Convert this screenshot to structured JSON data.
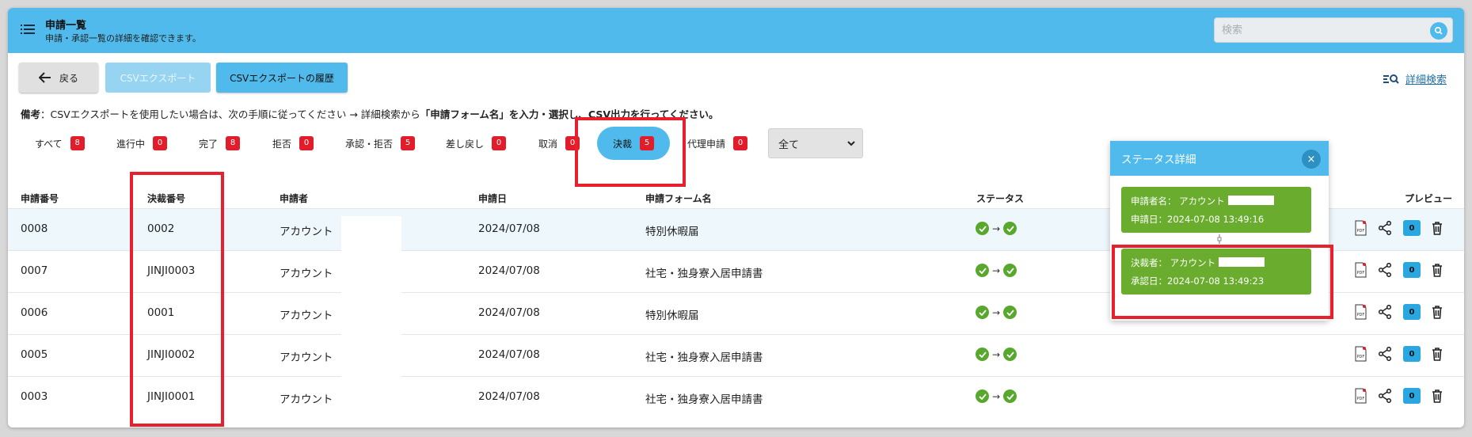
{
  "header": {
    "title": "申請一覧",
    "subtitle": "申請・承認一覧の詳細を確認できます。",
    "search_placeholder": "検索"
  },
  "toolbar": {
    "back_label": "戻る",
    "csv_export_label": "CSVエクスポート",
    "csv_history_label": "CSVエクスポートの履歴",
    "advanced_search_label": "詳細検索"
  },
  "note": {
    "prefix": "備考",
    "text": "：CSVエクスポートを使用したい場合は、次の手順に従ってください → 詳細検索から",
    "emphasis": "「申請フォーム名」を入力・選択し、",
    "suffix": "CSV出力を行ってください。"
  },
  "filters": [
    {
      "label": "すべて",
      "count": "8"
    },
    {
      "label": "進行中",
      "count": "0"
    },
    {
      "label": "完了",
      "count": "8"
    },
    {
      "label": "拒否",
      "count": "0"
    },
    {
      "label": "承認・拒否",
      "count": "5"
    },
    {
      "label": "差し戻し",
      "count": "0"
    },
    {
      "label": "取消",
      "count": "0"
    },
    {
      "label": "決裁",
      "count": "5"
    },
    {
      "label": "代理申請",
      "count": "0"
    }
  ],
  "select": {
    "value": "全て"
  },
  "table": {
    "headers": {
      "app_no": "申請番号",
      "decision_no": "決裁番号",
      "applicant": "申請者",
      "date": "申請日",
      "form": "申請フォーム名",
      "status": "ステータス",
      "preview": "プレビュー"
    },
    "rows": [
      {
        "app_no": "0008",
        "decision_no": "0002",
        "applicant": "アカウント",
        "date": "2024/07/08",
        "form": "特別休暇届",
        "count": "0"
      },
      {
        "app_no": "0007",
        "decision_no": "JINJI0003",
        "applicant": "アカウント",
        "date": "2024/07/08",
        "form": "社宅・独身寮入居申請書",
        "count": "0"
      },
      {
        "app_no": "0006",
        "decision_no": "0001",
        "applicant": "アカウント",
        "date": "2024/07/08",
        "form": "特別休暇届",
        "count": "0"
      },
      {
        "app_no": "0005",
        "decision_no": "JINJI0002",
        "applicant": "アカウント",
        "date": "2024/07/08",
        "form": "社宅・独身寮入居申請書",
        "count": "0"
      },
      {
        "app_no": "0003",
        "decision_no": "JINJI0001",
        "applicant": "アカウント",
        "date": "2024/07/08",
        "form": "社宅・独身寮入居申請書",
        "count": "0"
      }
    ]
  },
  "popup": {
    "title": "ステータス詳細",
    "close": "×",
    "card1": {
      "line1": "申請者名： アカウント",
      "line2": "申請日：2024-07-08 13:49:16"
    },
    "card2": {
      "line1": "決裁者： アカウント",
      "line2": "承認日：2024-07-08 13:49:23"
    }
  },
  "colors": {
    "accent": "#4fbaeb",
    "badge": "#e21d2b",
    "status_green": "#58a82d",
    "highlight_box": "#e8202d"
  }
}
